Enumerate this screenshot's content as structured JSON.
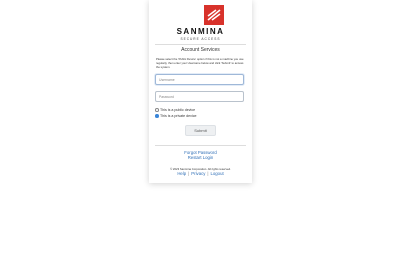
{
  "brand": {
    "name": "SANMINA",
    "tagline": "SECURE ACCESS",
    "accent_color": "#d8322b",
    "logo_icon": "sanmina-s-logo"
  },
  "title": "Account Services",
  "instructions": "Please select the 'Public Device' option if this is not a machine you use regularly, then enter your Username below and click 'Submit' to access the system.",
  "fields": {
    "username_placeholder": "Username",
    "password_placeholder": "Password"
  },
  "device_options": [
    {
      "label": "This is a public device",
      "checked": false
    },
    {
      "label": "This is a private device",
      "checked": true
    }
  ],
  "submit_label": "Submit",
  "links": {
    "forgot_password": "Forgot Password",
    "restart_login": "Restart Login"
  },
  "footer": {
    "copyright": "© 2023 Sanmina Corporation. All rights reserved.",
    "help": "Help",
    "privacy": "Privacy",
    "logout": "Logout",
    "separator": "|"
  },
  "link_color": "#2f6fb7"
}
